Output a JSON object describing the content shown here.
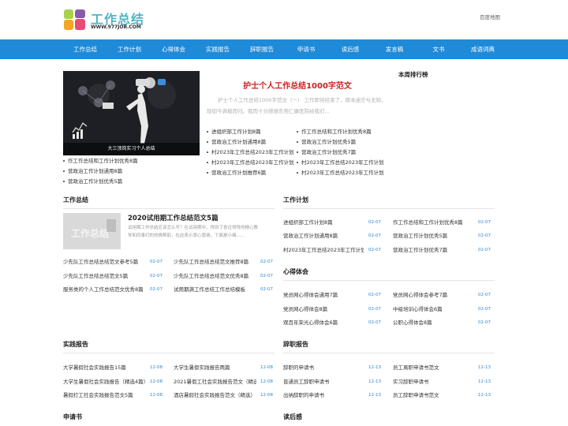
{
  "header": {
    "logo_title": "工作总结",
    "logo_url": "WWW.977JOB.COM",
    "baidu_map": "百度地图"
  },
  "nav": [
    "工作总结",
    "工作计划",
    "心得体会",
    "实践报告",
    "辞职报告",
    "申请书",
    "读后感",
    "发言稿",
    "文书",
    "成语词典"
  ],
  "hero": {
    "image_caption": "大三顶岗实习个人总结",
    "title": "护士个人工作总结1000字范文",
    "desc": "护士个人工作总结1000字范文（一） 工作即将结束了，原本迷茫与无知，现如今满载而归。我而十分感谢东莞仁康医院给我们...",
    "list_a": [
      "进组织部工作计划8篇",
      "营政治工作计划通用8篇",
      "村2023年工作总结2023年工作计划",
      "村2023年工作总结2023年工作计划",
      "营政治工作计划推荐6篇"
    ],
    "list_b": [
      "作工作总结和工作计划优秀8篇",
      "营政治工作计划优秀5篇",
      "营政治工作计划优秀7篇",
      "村2023年工作总结2023年工作计划",
      "村2023年工作总结2023年工作计划"
    ],
    "left_list": [
      "作工作总结和工作计划优秀8篇",
      "营政治工作计划通用8篇",
      "营政治工作计划优秀5篇"
    ]
  },
  "ranking": {
    "title": "本周排行榜"
  },
  "sections": {
    "gongzuo_zongjie": {
      "title": "工作总结",
      "featured_title": "2020试用期工作总结范文5篇",
      "featured_desc": "试用期工作总结应该怎么写？在试用期中，得到了各位领导的精心教导和同事们的热情帮助，在此表示衷心感谢。下面是小编......",
      "rows": [
        {
          "text": "少先队工作总结总结范文参考5篇",
          "date": "02-07"
        },
        {
          "text": "少先队工作总结总结范文推荐8篇",
          "date": "02-07"
        },
        {
          "text": "少先队工作总结总结范文5篇",
          "date": "02-07"
        },
        {
          "text": "少先队工作总结总结范文优秀8篇",
          "date": "02-07"
        },
        {
          "text": "服务类的个人工作总结范文优秀8篇",
          "date": "02-07"
        },
        {
          "text": "试用期满工作总结工作总结模板",
          "date": "02-07"
        }
      ]
    },
    "gongzuo_jihua": {
      "title": "工作计划",
      "rows": [
        {
          "text": "进组织部工作计划8篇",
          "date": "02-07"
        },
        {
          "text": "作工作总结和工作计划优秀8篇",
          "date": "02-07"
        },
        {
          "text": "营政治工作计划通用8篇",
          "date": "02-07"
        },
        {
          "text": "营政治工作计划优秀5篇",
          "date": "02-07"
        },
        {
          "text": "村2023年工作总结2023年工作计划",
          "date": "02-07"
        },
        {
          "text": "营政治工作计划优秀7篇",
          "date": "02-07"
        }
      ]
    },
    "xinde_tihui": {
      "title": "心得体会",
      "rows": [
        {
          "text": "党员网心得体会通用7篇",
          "date": "02-07"
        },
        {
          "text": "党员网心得体会参考7篇",
          "date": "02-07"
        },
        {
          "text": "党员网心得体会8篇",
          "date": "02-07"
        },
        {
          "text": "中级培训心得体会6篇",
          "date": "02-07"
        },
        {
          "text": "观百年荣光心得体会6篇",
          "date": "02-07"
        },
        {
          "text": "公职心得体会8篇",
          "date": "02-07"
        }
      ]
    },
    "shijian_baogao": {
      "title": "实践报告",
      "rows": [
        {
          "text": "大学暑假社会实践报告15篇",
          "date": "12-08"
        },
        {
          "text": "大学生暑假实践报告两篇",
          "date": "12-08"
        },
        {
          "text": "大学生暑假社会实践报告（精选4篇）",
          "date": "12-08"
        },
        {
          "text": "2021暑假工社会实践报告范文（精选）",
          "date": "12-08"
        },
        {
          "text": "暑假打工社会实践报告范文5篇",
          "date": "12-08"
        },
        {
          "text": "酒店暑假社会实践报告范文（精选）",
          "date": "12-08"
        }
      ]
    },
    "cizhi_baogao": {
      "title": "辞职报告",
      "rows": [
        {
          "text": "辞职的申请书",
          "date": "12-13"
        },
        {
          "text": "员工离职申请书范文",
          "date": "12-13"
        },
        {
          "text": "普通员工辞职申请书",
          "date": "12-13"
        },
        {
          "text": "实习辞职申请书",
          "date": "12-13"
        },
        {
          "text": "出纳辞职的申请书",
          "date": "12-13"
        },
        {
          "text": "员工辞职申请书范文",
          "date": "12-13"
        }
      ]
    },
    "shenqingshu": {
      "title": "申请书"
    },
    "duhougan": {
      "title": "读后感"
    }
  },
  "colors": {
    "nav_bg": "#1f8ad8",
    "hero_title": "#cc1f1f",
    "date": "#2d86d5",
    "logo_text": "#4fb4c4"
  }
}
